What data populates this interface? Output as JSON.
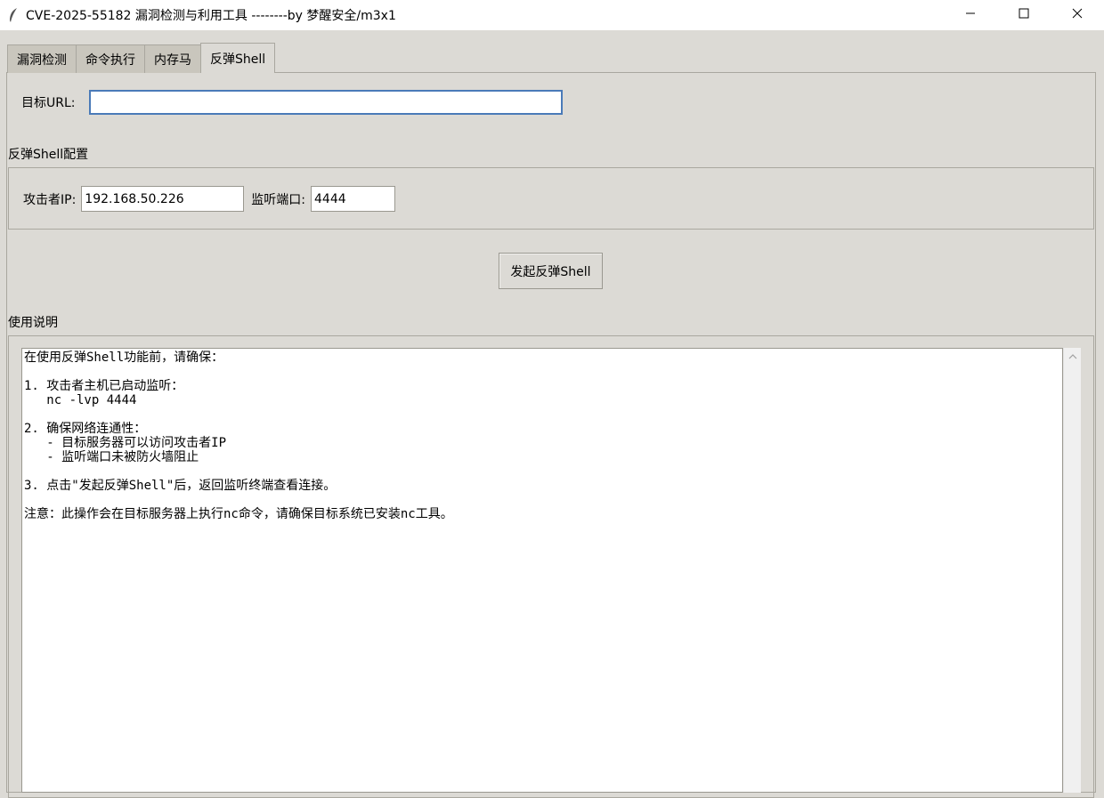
{
  "window": {
    "title": "CVE-2025-55182 漏洞检测与利用工具 --------by 梦醒安全/m3x1",
    "icon": "feather-icon"
  },
  "tabs": [
    {
      "label": "漏洞检测",
      "active": false
    },
    {
      "label": "命令执行",
      "active": false
    },
    {
      "label": "内存马",
      "active": false
    },
    {
      "label": "反弹Shell",
      "active": true
    }
  ],
  "target": {
    "label": "目标URL:",
    "value": ""
  },
  "config": {
    "section_label": "反弹Shell配置",
    "ip_label": "攻击者IP:",
    "ip_value": "192.168.50.226",
    "port_label": "监听端口:",
    "port_value": "4444"
  },
  "action": {
    "button_label": "发起反弹Shell"
  },
  "usage": {
    "section_label": "使用说明",
    "text": "在使用反弹Shell功能前，请确保：\n\n1. 攻击者主机已启动监听：\n   nc -lvp 4444\n\n2. 确保网络连通性：\n   - 目标服务器可以访问攻击者IP\n   - 监听端口未被防火墙阻止\n\n3. 点击\"发起反弹Shell\"后，返回监听终端查看连接。\n\n注意：此操作会在目标服务器上执行nc命令，请确保目标系统已安装nc工具。"
  },
  "colors": {
    "background": "#dcdad5",
    "input_focus_border": "#4a7ab8"
  }
}
